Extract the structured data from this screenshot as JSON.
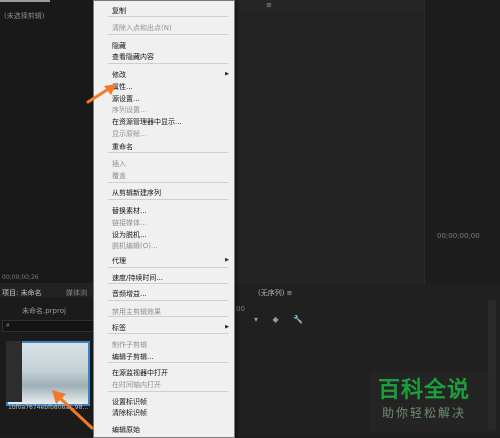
{
  "source_monitor": {
    "title": "(未选择剪辑)",
    "timecode": "00;00;00;26"
  },
  "program_monitor": {
    "tab_menu": "≡"
  },
  "right_panel": {
    "timecode": "00;00;00;00"
  },
  "project_panel": {
    "tab_label": "项目: 未命名",
    "tab_menu": "≡",
    "media_tab_label": "媒体浏",
    "file_name": "未命名.prproj",
    "search_icon": "search-icon",
    "clip_name": "1bf0a7674ebfb808a...98..."
  },
  "timeline_panel": {
    "tab_label": "(无序列) ≡",
    "time": "00",
    "tools": "▾ ◆ 🔧"
  },
  "context_menu": {
    "items": [
      {
        "label": "复制",
        "disabled": false
      },
      {
        "label": "清除入点和出点(N)",
        "disabled": true
      },
      {
        "label": "隐藏",
        "disabled": false
      },
      {
        "label": "查看隐藏内容",
        "disabled": false
      },
      {
        "label": "修改",
        "disabled": false,
        "submenu": true
      },
      {
        "label": "属性...",
        "disabled": false
      },
      {
        "label": "源设置...",
        "disabled": false
      },
      {
        "label": "序列设置...",
        "disabled": true
      },
      {
        "label": "在资源管理器中显示...",
        "disabled": false
      },
      {
        "label": "显示原帧...",
        "disabled": true
      },
      {
        "label": "重命名",
        "disabled": false
      },
      {
        "label": "插入",
        "disabled": true
      },
      {
        "label": "覆盖",
        "disabled": true
      },
      {
        "label": "从剪辑新建序列",
        "disabled": false
      },
      {
        "label": "替换素材...",
        "disabled": false
      },
      {
        "label": "链接媒体...",
        "disabled": true
      },
      {
        "label": "设为脱机...",
        "disabled": false
      },
      {
        "label": "脱机编辑(O)...",
        "disabled": true
      },
      {
        "label": "代理",
        "disabled": false,
        "submenu": true
      },
      {
        "label": "速度/持续时间...",
        "disabled": false
      },
      {
        "label": "音频增益...",
        "disabled": false
      },
      {
        "label": "禁用主剪辑效果",
        "disabled": true
      },
      {
        "label": "标签",
        "disabled": false,
        "submenu": true
      },
      {
        "label": "制作子剪辑",
        "disabled": true
      },
      {
        "label": "编辑子剪辑...",
        "disabled": false
      },
      {
        "label": "在源监视器中打开",
        "disabled": false
      },
      {
        "label": "在时间轴内打开",
        "disabled": true
      },
      {
        "label": "设置标识帧",
        "disabled": false
      },
      {
        "label": "清除标识帧",
        "disabled": false
      },
      {
        "label": "编辑原始",
        "disabled": false
      }
    ]
  },
  "watermark": {
    "title": "百科全说",
    "subtitle": "助你轻松解决"
  },
  "colors": {
    "menu_bg": "#f0f0f0",
    "annotation_arrow": "#f07a2a",
    "watermark_green": "#1c9e3b",
    "selection_blue": "#3c84c4"
  }
}
